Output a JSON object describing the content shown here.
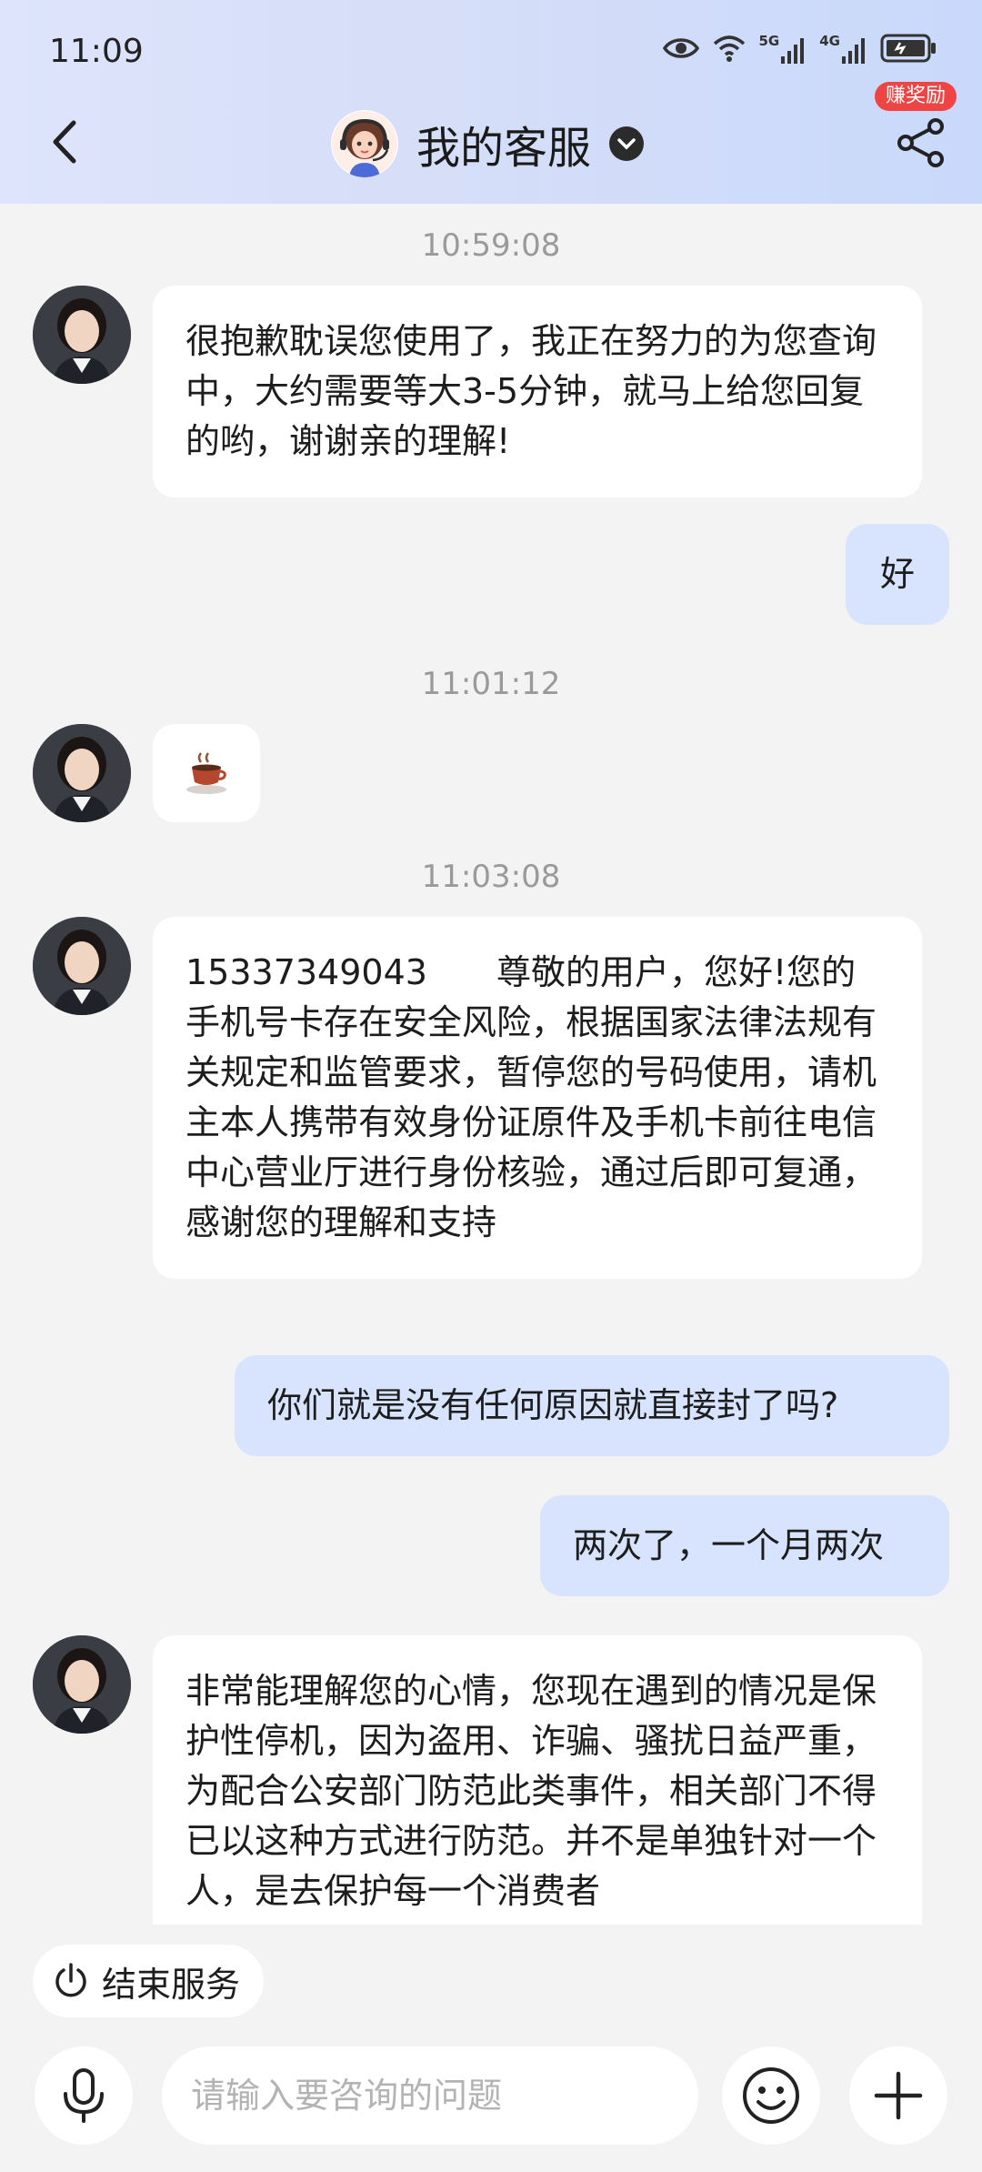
{
  "status_bar": {
    "time": "11:09",
    "signal1": "5G",
    "signal2": "4G"
  },
  "header": {
    "title": "我的客服",
    "reward_badge": "赚奖励"
  },
  "chat": {
    "ts1": "10:59:08",
    "msg1": "很抱歉耽误您使用了，我正在努力的为您查询中，大约需要等大3-5分钟，就马上给您回复的哟，谢谢亲的理解!",
    "reply1": "好",
    "ts2": "11:01:12",
    "ts3": "11:03:08",
    "msg3": "15337349043　　尊敬的用户，您好!您的手机号卡存在安全风险，根据国家法律法规有关规定和监管要求，暂停您的号码使用，请机主本人携带有效身份证原件及手机卡前往电信中心营业厅进行身份核验，通过后即可复通，感谢您的理解和支持",
    "reply2": "你们就是没有任何原因就直接封了吗?",
    "reply3": "两次了，一个月两次",
    "msg4": "非常能理解您的心情，您现在遇到的情况是保护性停机，因为盗用、诈骗、骚扰日益严重，为配合公安部门防范此类事件，相关部门不得已以这种方式进行防范。并不是单独针对一个人，是去保护每一个消费者"
  },
  "bottom": {
    "end_service": "结束服务",
    "input_placeholder": "请输入要咨询的问题"
  }
}
